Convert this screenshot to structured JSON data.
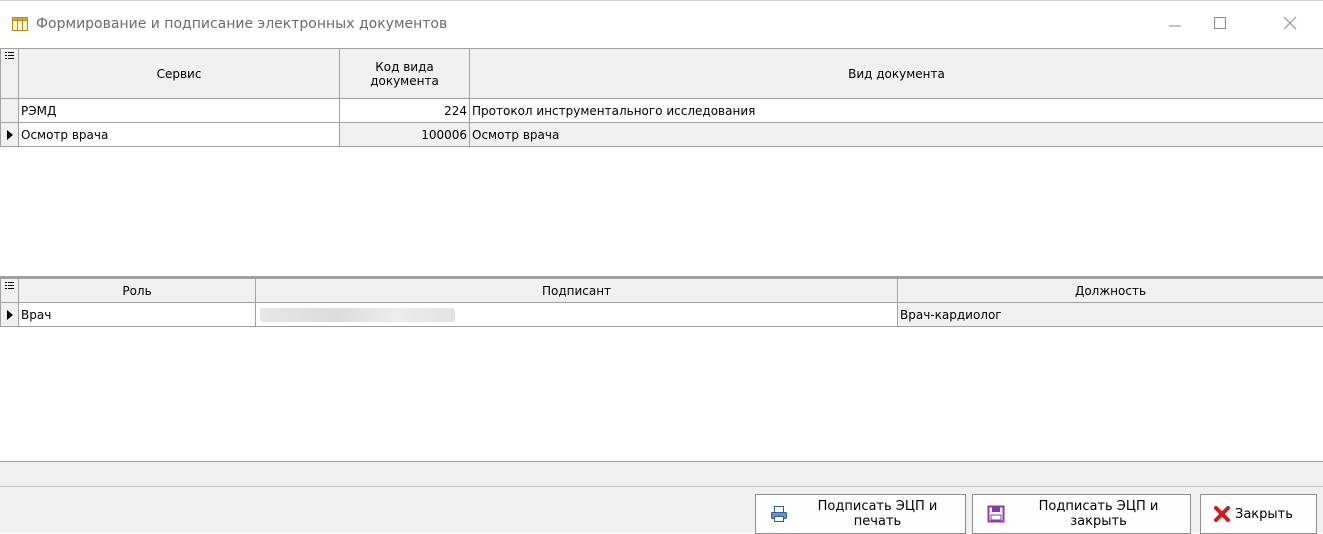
{
  "window": {
    "title": "Формирование и подписание электронных документов",
    "icon": "table-icon",
    "controls": [
      "minimize-icon",
      "maximize-icon",
      "close-icon"
    ]
  },
  "documents": {
    "columns": {
      "service": "Сервис",
      "code_line1": "Код вида",
      "code_line2": "документа",
      "type": "Вид документа"
    },
    "rows": [
      {
        "service": "РЭМД",
        "code": "224",
        "type": "Протокол инструментального исследования",
        "selected": false
      },
      {
        "service": "Осмотр врача",
        "code": "100006",
        "type": "Осмотр врача",
        "selected": true
      }
    ]
  },
  "signers": {
    "columns": {
      "role": "Роль",
      "signer": "Подписант",
      "position": "Должность"
    },
    "rows": [
      {
        "role": "Врач",
        "signer": "",
        "position": "Врач-кардиолог",
        "selected": true
      }
    ]
  },
  "buttons": {
    "sign_print_line1": "Подписать ЭЦП и",
    "sign_print_line2": "печать",
    "sign_close_line1": "Подписать ЭЦП и",
    "sign_close_line2": "закрыть",
    "close": "Закрыть"
  },
  "colors": {
    "close_icon_red": "#d01c1c",
    "save_icon_purple": "#8e3aa6",
    "header_bg": "#f0f0f0"
  }
}
